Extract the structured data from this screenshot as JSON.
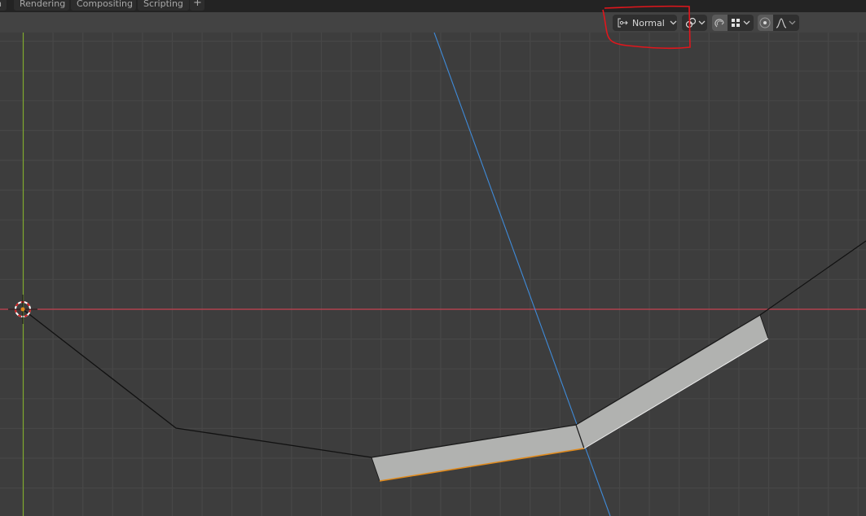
{
  "workspace_tabs": [
    {
      "label": "n"
    },
    {
      "label": "Rendering"
    },
    {
      "label": "Compositing"
    },
    {
      "label": "Scripting"
    },
    {
      "label": "+"
    }
  ],
  "header": {
    "transform_orientation": {
      "icon": "transform-orientation-icon",
      "value": "Normal"
    },
    "pivot_point": {
      "icon": "pivot-point-icon"
    },
    "snap_toggle": {
      "icon": "snap-magnet-icon",
      "active": true
    },
    "snap_target": {
      "icon": "snap-increment-icon"
    },
    "proportional_edit": {
      "icon": "proportional-edit-icon",
      "active": true
    },
    "proportional_falloff": {
      "icon": "falloff-curve-icon"
    }
  },
  "annotation": {
    "color": "#e0161c",
    "description": "red freehand circle around transform orientation dropdown"
  },
  "viewport": {
    "axis_colors": {
      "x": "#c5414f",
      "y": "#7fa82e",
      "view": "#3f8ad8"
    },
    "mesh_color": "#b1b2b0",
    "selected_edge_color": "#e08a1c",
    "grid_color": "#474747"
  }
}
